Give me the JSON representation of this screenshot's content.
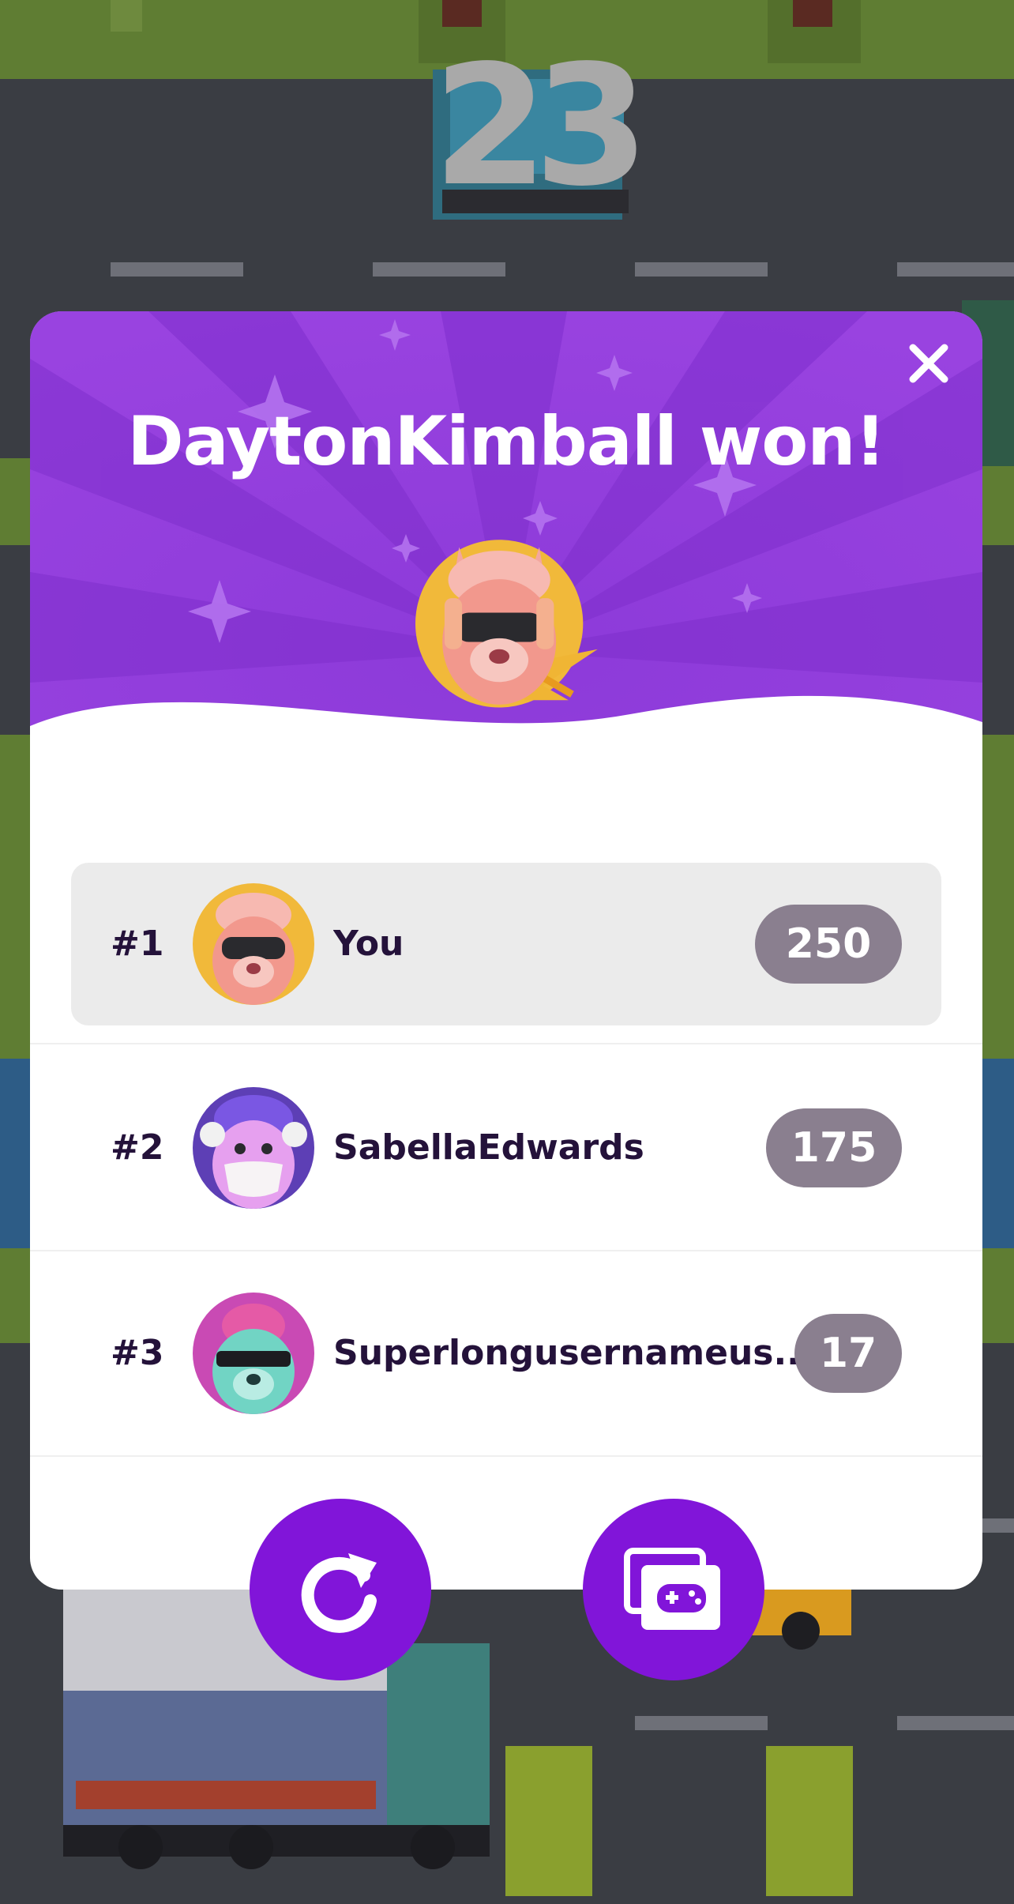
{
  "game": {
    "score": "23"
  },
  "modal": {
    "title": "DaytonKimball won!",
    "close_icon": "close-icon",
    "colors": {
      "hero": "#8a34d8",
      "button": "#8115d9",
      "pill": "#8a7f8f",
      "text": "#24123a"
    }
  },
  "leaderboard": [
    {
      "rank": "#1",
      "name": "You",
      "score": "250",
      "avatar": "llama-sunglasses-avatar"
    },
    {
      "rank": "#2",
      "name": "SabellaEdwards",
      "score": "175",
      "avatar": "llama-mask-avatar"
    },
    {
      "rank": "#3",
      "name": "Superlongusernameus...",
      "score": "17",
      "avatar": "llama-flamingo-avatar"
    }
  ],
  "actions": [
    {
      "icon": "replay-icon"
    },
    {
      "icon": "game-library-icon"
    }
  ]
}
